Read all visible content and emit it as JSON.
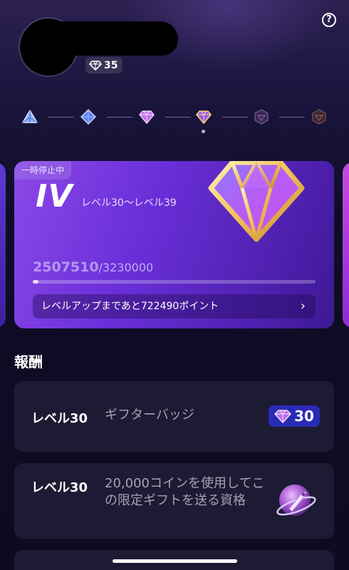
{
  "header": {
    "help_label": "?",
    "gem_count": "35"
  },
  "tiers": [
    {
      "name": "tier-1",
      "color": "#9ab8ff"
    },
    {
      "name": "tier-2",
      "color": "#6a8cff"
    },
    {
      "name": "tier-3",
      "color": "#d080ff"
    },
    {
      "name": "tier-4",
      "color": "#b070ff",
      "selected": true
    },
    {
      "name": "tier-5",
      "color": "#5a3a8a",
      "locked": true
    },
    {
      "name": "tier-6",
      "color": "#5a3a8a",
      "locked": true
    }
  ],
  "level_card": {
    "paused_tag": "一時停止中",
    "tier_roman": "IV",
    "level_range": "レベル30〜レベル39",
    "current_points": "2507510",
    "max_points": "/3230000",
    "progress_fraction": 0.02,
    "next_level_text": "レベルアップまであと722490ポイント",
    "next_chevron": "›"
  },
  "rewards": {
    "section_title": "報酬",
    "items": [
      {
        "level": "レベル30",
        "description": "ギフターバッジ",
        "badge_value": "30"
      },
      {
        "level": "レベル30",
        "description": "20,000コインを使用してこの限定ギフトを送る資格"
      }
    ]
  },
  "colors": {
    "accent": "#7b3fe4",
    "chip": "#2a2bb5",
    "card_bg": "#1d1a33",
    "page_bg": "#0d0b22"
  }
}
